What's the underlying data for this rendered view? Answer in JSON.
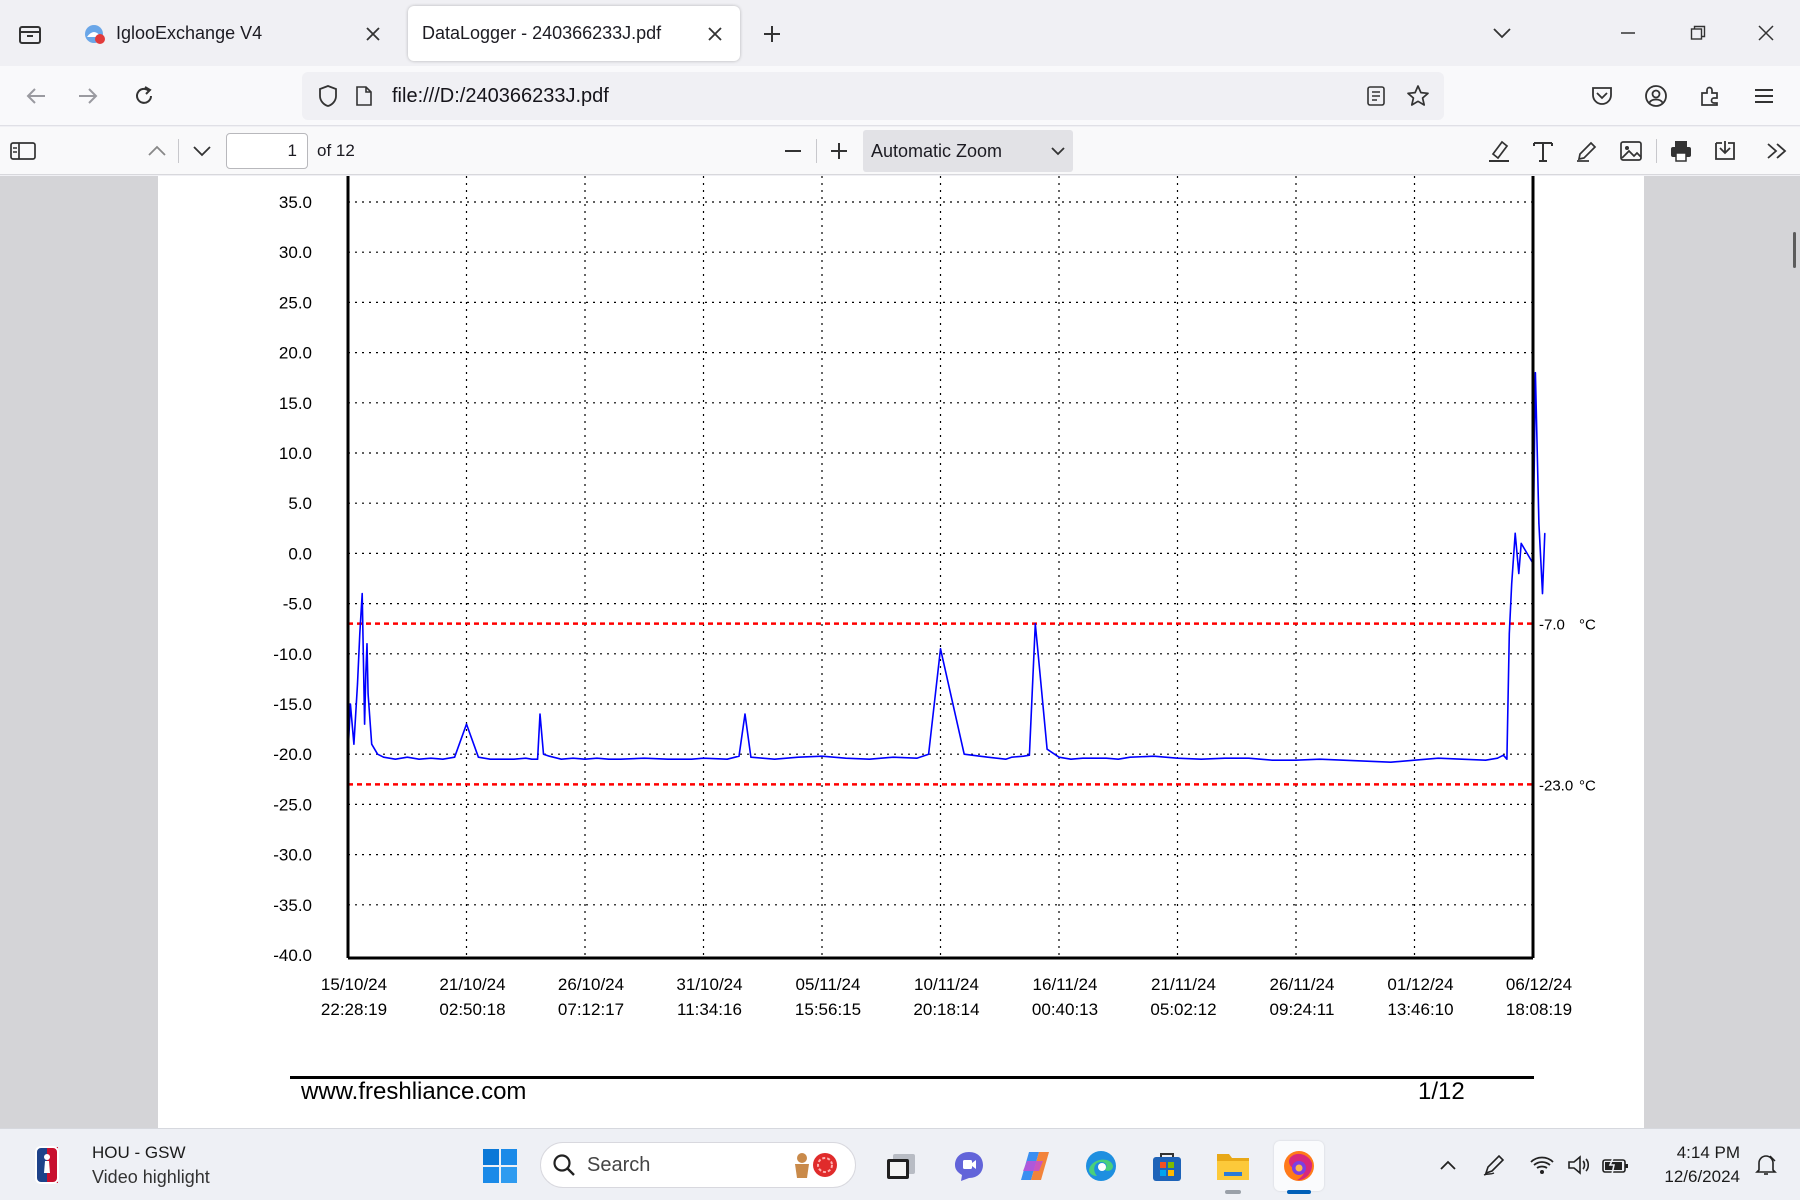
{
  "browser": {
    "tabs": [
      {
        "title": "IglooExchange V4",
        "active": false
      },
      {
        "title": "DataLogger - 240366233J.pdf",
        "active": true
      }
    ],
    "url": "file:///D:/240366233J.pdf"
  },
  "pdf_toolbar": {
    "page_current": "1",
    "page_count_label": "of 12",
    "zoom_label": "Automatic Zoom"
  },
  "chart_data": {
    "type": "line",
    "title": "",
    "xlabel": "",
    "ylabel": "",
    "ylim": [
      -40,
      35
    ],
    "y_ticks": [
      "35.0",
      "30.0",
      "25.0",
      "20.0",
      "15.0",
      "10.0",
      "5.0",
      "0.0",
      "-5.0",
      "-10.0",
      "-15.0",
      "-20.0",
      "-25.0",
      "-30.0",
      "-35.0",
      "-40.0"
    ],
    "x_ticks": [
      {
        "date": "15/10/24",
        "time": "22:28:19"
      },
      {
        "date": "21/10/24",
        "time": "02:50:18"
      },
      {
        "date": "26/10/24",
        "time": "07:12:17"
      },
      {
        "date": "31/10/24",
        "time": "11:34:16"
      },
      {
        "date": "05/11/24",
        "time": "15:56:15"
      },
      {
        "date": "10/11/24",
        "time": "20:18:14"
      },
      {
        "date": "16/11/24",
        "time": "00:40:13"
      },
      {
        "date": "21/11/24",
        "time": "05:02:12"
      },
      {
        "date": "26/11/24",
        "time": "09:24:11"
      },
      {
        "date": "01/12/24",
        "time": "13:46:10"
      },
      {
        "date": "06/12/24",
        "time": "18:08:19"
      }
    ],
    "grid": true,
    "thresholds": [
      {
        "value": -7.0,
        "label": "-7.0",
        "unit": "°C",
        "color": "#ff0000"
      },
      {
        "value": -23.0,
        "label": "-23.0",
        "unit": "°C",
        "color": "#ff0000"
      }
    ],
    "series": [
      {
        "color": "#0000ff",
        "x": [
          0.0,
          0.02,
          0.05,
          0.08,
          0.1,
          0.12,
          0.14,
          0.15,
          0.16,
          0.17,
          0.2,
          0.25,
          0.3,
          0.4,
          0.5,
          0.6,
          0.7,
          0.8,
          0.9,
          1.0,
          1.1,
          1.2,
          1.3,
          1.4,
          1.5,
          1.55,
          1.6,
          1.62,
          1.65,
          1.7,
          1.8,
          1.9,
          2.0,
          2.1,
          2.2,
          2.3,
          2.5,
          2.7,
          2.8,
          2.9,
          3.0,
          3.2,
          3.3,
          3.35,
          3.4,
          3.5,
          3.6,
          3.8,
          4.0,
          4.2,
          4.4,
          4.6,
          4.8,
          4.85,
          4.9,
          5.0,
          5.2,
          5.4,
          5.55,
          5.6,
          5.7,
          5.75,
          5.8,
          5.9,
          6.0,
          6.1,
          6.2,
          6.4,
          6.5,
          6.6,
          6.8,
          7.0,
          7.2,
          7.4,
          7.6,
          7.7,
          7.8,
          7.9,
          8.0,
          8.2,
          8.4,
          8.6,
          8.8,
          9.0,
          9.2,
          9.4,
          9.6,
          9.7,
          9.75,
          9.78,
          9.8,
          9.82,
          9.85,
          9.88,
          9.9,
          9.95,
          10.0,
          10.02,
          10.05,
          10.08,
          10.1
        ],
        "values": [
          -20,
          -15,
          -19,
          -13,
          -8,
          -4,
          -17,
          -12,
          -9,
          -14,
          -19,
          -20,
          -20.3,
          -20.5,
          -20.3,
          -20.5,
          -20.4,
          -20.5,
          -20.3,
          -17,
          -20.3,
          -20.5,
          -20.5,
          -20.5,
          -20.4,
          -20.5,
          -20.5,
          -16,
          -20,
          -20.2,
          -20.5,
          -20.4,
          -20.5,
          -20.4,
          -20.5,
          -20.5,
          -20.4,
          -20.5,
          -20.5,
          -20.5,
          -20.4,
          -20.5,
          -20.2,
          -16,
          -20.3,
          -20.4,
          -20.5,
          -20.3,
          -20.2,
          -20.4,
          -20.5,
          -20.3,
          -20.4,
          -20.2,
          -20,
          -9.5,
          -20,
          -20.3,
          -20.5,
          -20.3,
          -20.2,
          -20.1,
          -7,
          -19.5,
          -20.3,
          -20.5,
          -20.4,
          -20.4,
          -20.5,
          -20.3,
          -20.2,
          -20.4,
          -20.5,
          -20.4,
          -20.4,
          -20.5,
          -20.6,
          -20.6,
          -20.6,
          -20.5,
          -20.6,
          -20.7,
          -20.8,
          -20.6,
          -20.4,
          -20.5,
          -20.6,
          -20.4,
          -20.1,
          -20.5,
          -8,
          -3,
          2,
          -2,
          1,
          0,
          -1,
          18,
          3,
          -4,
          2
        ]
      }
    ],
    "footer": {
      "url": "www.freshliance.com",
      "page": "1/12"
    }
  },
  "taskbar": {
    "news_title": "HOU - GSW",
    "news_subtitle": "Video highlight",
    "search_label": "Search",
    "clock_time": "4:14 PM",
    "clock_date": "12/6/2024"
  }
}
